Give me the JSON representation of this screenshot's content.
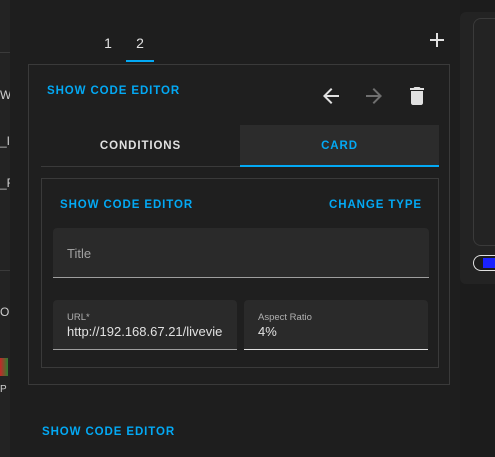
{
  "colors": {
    "accent": "#03a9f4",
    "background": "#1c1c1c",
    "card_background": "#1f1f1f",
    "text": "#e1e1e1",
    "border": "#3a3a3a"
  },
  "left_fragments": [
    "W",
    "_I",
    "_F",
    "O",
    "P"
  ],
  "tabs": [
    {
      "label": "1",
      "active": false
    },
    {
      "label": "2",
      "active": true
    }
  ],
  "add_tab_icon": "plus-icon",
  "outer_card": {
    "show_code_editor": "SHOW CODE EDITOR",
    "icons": [
      "arrow-left-icon",
      "arrow-right-icon",
      "delete-icon"
    ],
    "toggle": {
      "conditions": "CONDITIONS",
      "card": "CARD",
      "active": "card"
    }
  },
  "inner_card": {
    "show_code_editor": "SHOW CODE EDITOR",
    "change_type": "CHANGE TYPE",
    "title_field": {
      "placeholder": "Title",
      "value": ""
    },
    "url_field": {
      "label": "URL*",
      "value": "http://192.168.67.21/livevie"
    },
    "aspect_ratio_field": {
      "label": "Aspect Ratio",
      "value": "4%"
    }
  },
  "bottom": {
    "show_code_editor": "SHOW CODE EDITOR"
  }
}
